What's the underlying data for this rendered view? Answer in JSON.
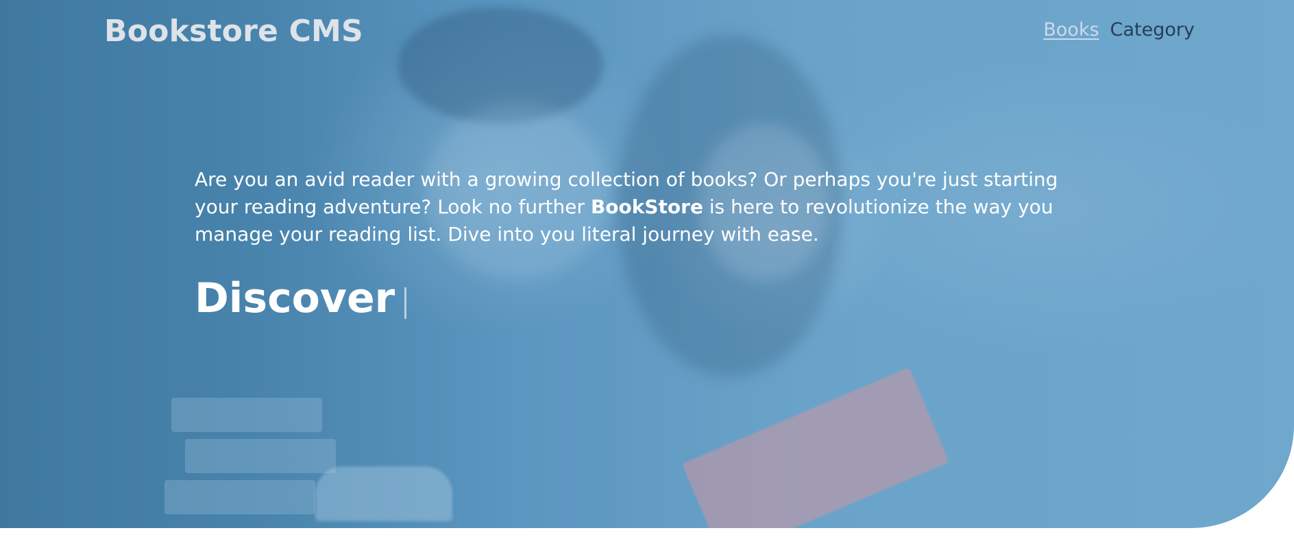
{
  "header": {
    "brand": "Bookstore CMS",
    "nav": [
      {
        "label": "Books",
        "active": true
      },
      {
        "label": "Category",
        "active": false
      }
    ]
  },
  "hero": {
    "intro_before": "Are you an avid reader with a growing collection of books? Or perhaps you're just starting your reading adventure? Look no further ",
    "intro_brand": "BookStore",
    "intro_after": " is here to revolutionize the way you manage your reading list. Dive into you literal journey with ease.",
    "typed_word": "Discover",
    "cursor_glyph": "|"
  },
  "colors": {
    "overlay": "#4a86b0",
    "text": "#ffffff",
    "nav_inactive": "#263f55",
    "nav_active": "#c9dbe9"
  }
}
